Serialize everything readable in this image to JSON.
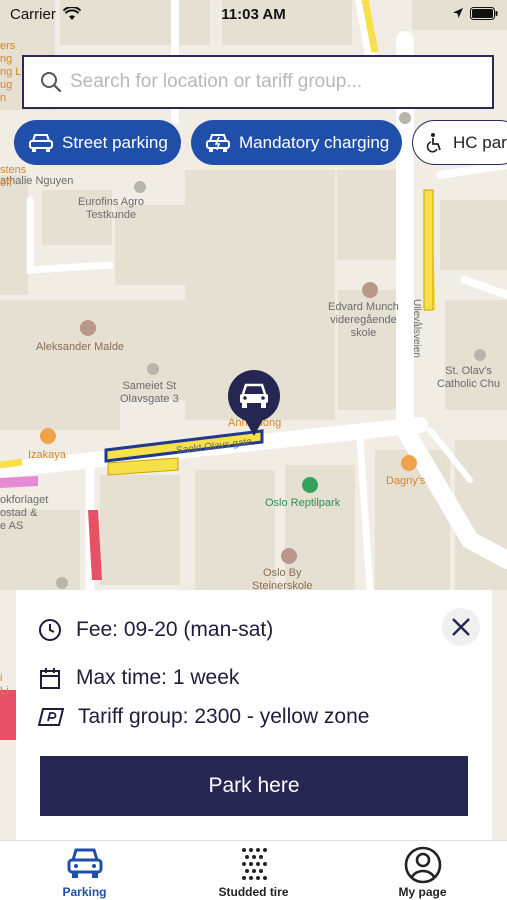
{
  "status_bar": {
    "carrier": "Carrier",
    "time": "11:03 AM"
  },
  "search": {
    "placeholder": "Search for location or tariff group..."
  },
  "filters": [
    {
      "label": "Street parking",
      "icon": "car-icon",
      "active": true
    },
    {
      "label": "Mandatory charging",
      "icon": "charging-car-icon",
      "active": true
    },
    {
      "label": "HC par",
      "icon": "wheelchair-icon",
      "active": false
    }
  ],
  "map": {
    "labels": {
      "eurofins": "Eurofins Agro\nTestkunde",
      "nathalie": "athalie Nguyen",
      "edvard": "Edvard Munch\nvideregående\nskole",
      "aleksander": "Aleksander Malde",
      "sameiet": "Sameiet St\nOlavsgate 3",
      "anh": "Anh Luong",
      "izakaya": "Izakaya",
      "sankt": "Sankt Olavs gate",
      "ullevaal": "Ullevålsveien",
      "stolav": "St. Olav's\nCatholic Chu",
      "dagny": "Dagny's",
      "reptil": "Oslo Reptilpark",
      "steiner": "Oslo By\nSteinerskole",
      "bokforlaget": "okforlaget\nostad &\ne AS",
      "corner_top": "ers\nng\nng L\nug\nn",
      "stens": "stens\noff",
      "corner_left": "i\nLi"
    }
  },
  "colors": {
    "brand_blue": "#1f4fa8",
    "navy": "#262652",
    "yellow_zone": "#f7e04a"
  },
  "info_panel": {
    "fee_text": "Fee:  09-20 (man-sat)",
    "max_time_text": "Max time: 1 week",
    "tariff_text": "Tariff group: 2300 - yellow zone",
    "park_button": "Park here"
  },
  "tabs": [
    {
      "label": "Parking",
      "icon": "car-icon",
      "active": true
    },
    {
      "label": "Studded tire",
      "icon": "studded-tire-icon",
      "active": false
    },
    {
      "label": "My page",
      "icon": "user-icon",
      "active": false
    }
  ]
}
